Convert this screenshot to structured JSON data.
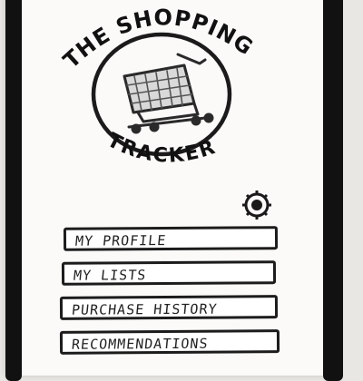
{
  "app": {
    "title_top": "THE SHOPPING",
    "title_bottom": "TRACKER",
    "logo_icon": "shopping-cart-icon"
  },
  "header": {
    "settings_icon": "gear-icon"
  },
  "menu": {
    "items": [
      {
        "label": "MY PROFILE"
      },
      {
        "label": "MY LISTS"
      },
      {
        "label": "PURCHASE HISTORY"
      },
      {
        "label": "RECOMMENDATIONS"
      }
    ]
  }
}
